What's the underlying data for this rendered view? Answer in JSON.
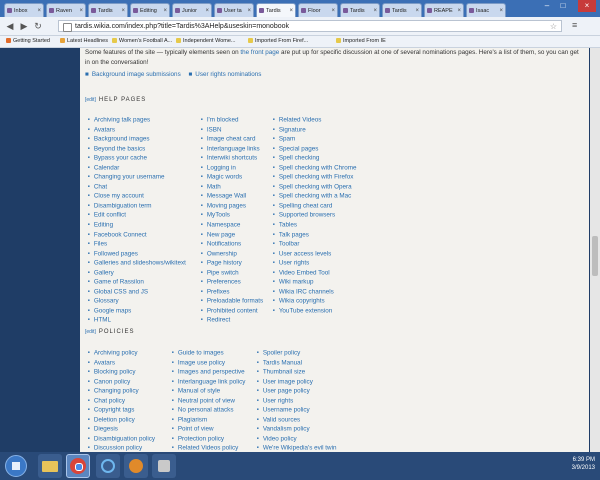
{
  "tabs": [
    {
      "label": "Inbox",
      "active": false
    },
    {
      "label": "Raven",
      "active": false
    },
    {
      "label": "Tardis",
      "active": false
    },
    {
      "label": "Editing",
      "active": false
    },
    {
      "label": "Junior",
      "active": false
    },
    {
      "label": "User ta",
      "active": false
    },
    {
      "label": "Tardis",
      "active": true
    },
    {
      "label": "Floor",
      "active": false
    },
    {
      "label": "Tardis",
      "active": false
    },
    {
      "label": "Tardis",
      "active": false
    },
    {
      "label": "REAPE",
      "active": false
    },
    {
      "label": "Isaac",
      "active": false
    }
  ],
  "address": {
    "url": "tardis.wikia.com/index.php?title=Tardis%3AHelp&useskin=monobook"
  },
  "bookmarks": [
    {
      "label": "Getting Started",
      "color": "#e06b2a"
    },
    {
      "label": "Latest Headlines",
      "color": "#e6a23a"
    },
    {
      "label": "Women's Football A...",
      "color": "#e6c94a"
    },
    {
      "label": "Independent Wome...",
      "color": "#e6c94a"
    },
    {
      "label": "Imported From Firef...",
      "color": "#e6c94a"
    },
    {
      "label": "Imported From IE",
      "color": "#e6c94a"
    }
  ],
  "intro": {
    "text_before": "Some features of the site — typically elements seen on ",
    "link": "the front page",
    "text_after": " are put up for specific discussion at one of several nominations pages. Here's a list of them, so you can get in on the conversation!"
  },
  "nominations": [
    "Background image submissions",
    "User rights nominations"
  ],
  "help_pages": {
    "edit": "[edit]",
    "title": "HELP PAGES",
    "col1": [
      "Archiving talk pages",
      "Avatars",
      "Background images",
      "Beyond the basics",
      "Bypass your cache",
      "Calendar",
      "Changing your username",
      "Chat",
      "Close my account",
      "Disambiguation term",
      "Edit conflict",
      "Editing",
      "Facebook Connect",
      "Files",
      "Followed pages",
      "Galleries and slideshows/wikitext",
      "Gallery",
      "Game of Rassilon",
      "Global CSS and JS",
      "Glossary",
      "Google maps",
      "HTML"
    ],
    "col2": [
      "I'm blocked",
      "ISBN",
      "Image cheat card",
      "Interlanguage links",
      "Interwiki shortcuts",
      "Logging in",
      "Magic words",
      "Math",
      "Message Wall",
      "Moving pages",
      "MyTools",
      "Namespace",
      "New page",
      "Notifications",
      "Ownership",
      "Page history",
      "Pipe switch",
      "Preferences",
      "Prefixes",
      "Preloadable formats",
      "Prohibited content",
      "Redirect"
    ],
    "col3": [
      "Related Videos",
      "Signature",
      "Spam",
      "Special pages",
      "Spell checking",
      "Spell checking with Chrome",
      "Spell checking with Firefox",
      "Spell checking with Opera",
      "Spell checking with a Mac",
      "Spelling cheat card",
      "Supported browsers",
      "Tables",
      "Talk pages",
      "Toolbar",
      "User access levels",
      "User rights",
      "Video Embed Tool",
      "Wiki markup",
      "Wikia IRC channels",
      "Wikia copyrights",
      "YouTube extension"
    ]
  },
  "policies": {
    "edit": "[edit]",
    "title": "POLICIES",
    "col1": [
      "Archiving policy",
      "Avatars",
      "Blocking policy",
      "Canon policy",
      "Changing policy",
      "Chat policy",
      "Copyright tags",
      "Deletion policy",
      "Diegesis",
      "Disambiguation policy",
      "Discussion policy"
    ],
    "col2": [
      "Guide to images",
      "Image use policy",
      "Images and perspective",
      "Interlanguage link policy",
      "Manual of style",
      "Neutral point of view",
      "No personal attacks",
      "Plagiarism",
      "Point of view",
      "Protection policy",
      "Related Videos policy"
    ],
    "col3": [
      "Spoiler policy",
      "Tardis Manual",
      "Thumbnail size",
      "User image policy",
      "User page policy",
      "User rights",
      "Username policy",
      "Valid sources",
      "Vandalism policy",
      "Video policy",
      "We're Wikipedia's evil twin"
    ]
  },
  "clock": {
    "time": "6:39 PM",
    "date": "3/9/2013"
  }
}
